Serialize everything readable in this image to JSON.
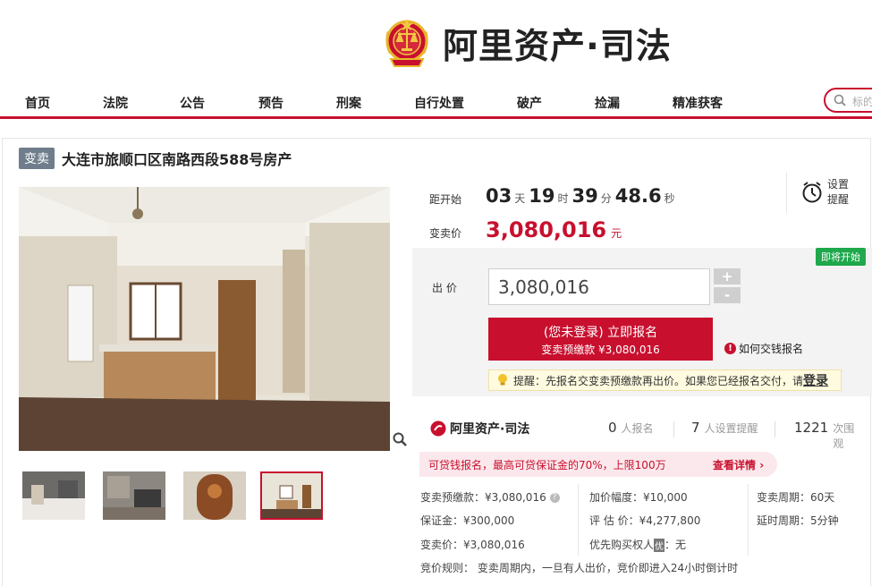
{
  "header": {
    "brand": "阿里资产·司法"
  },
  "nav": {
    "items": [
      "首页",
      "法院",
      "公告",
      "预告",
      "刑案",
      "自行处置",
      "破产",
      "捡漏",
      "精准获客"
    ],
    "search_placeholder": "标的"
  },
  "item": {
    "tag": "变卖",
    "title": "大连市旅顺口区南路西段588号房产"
  },
  "auction": {
    "countdown_label": "距开始",
    "days": "03",
    "days_unit": "天",
    "hours": "19",
    "hours_unit": "时",
    "minutes": "39",
    "minutes_unit": "分",
    "seconds": "48.6",
    "seconds_unit": "秒",
    "remind_label": "设置提醒",
    "price_label": "变卖价",
    "price": "3,080,016",
    "price_unit": "元",
    "status_badge": "即将开始",
    "bid_label": "出 价",
    "bid_value": "3,080,016",
    "plus": "+",
    "minus": "-",
    "apply_line1": "(您未登录) 立即报名",
    "apply_line2": "变卖预缴款 ¥3,080,016",
    "how_to_pay": "如何交钱报名",
    "hint_text": "提醒：先报名交变卖预缴款再出价。如果您已经报名交付，请",
    "hint_login": "登录"
  },
  "stats": {
    "brand": "阿里资产·司法",
    "signup_count": "0",
    "signup_unit": "人报名",
    "remind_count": "7",
    "remind_unit": "人设置提醒",
    "view_count": "1221",
    "view_unit": "次围观"
  },
  "promo": {
    "text": "可贷钱报名，最高可贷保证金的70%，上限100万",
    "more": "查看详情"
  },
  "details": {
    "prepay": "变卖预缴款：¥3,080,016",
    "increment": "加价幅度：¥10,000",
    "period": "变卖周期：60天",
    "deposit": "保证金：¥300,000",
    "appraisal": "评 估 价：¥4,277,800",
    "delay": "延时周期：5分钟",
    "sale_price": "变卖价：¥3,080,016",
    "priority_label": "优先购买权人",
    "priority_badge": "优",
    "priority_value": "：无",
    "rule": "竞价规则：  变卖周期内，一旦有人出价，竞价即进入24小时倒计时"
  },
  "colors": {
    "accent": "#c8102e",
    "tag_bg": "#6f7d8c",
    "badge_green": "#1fa84c"
  }
}
